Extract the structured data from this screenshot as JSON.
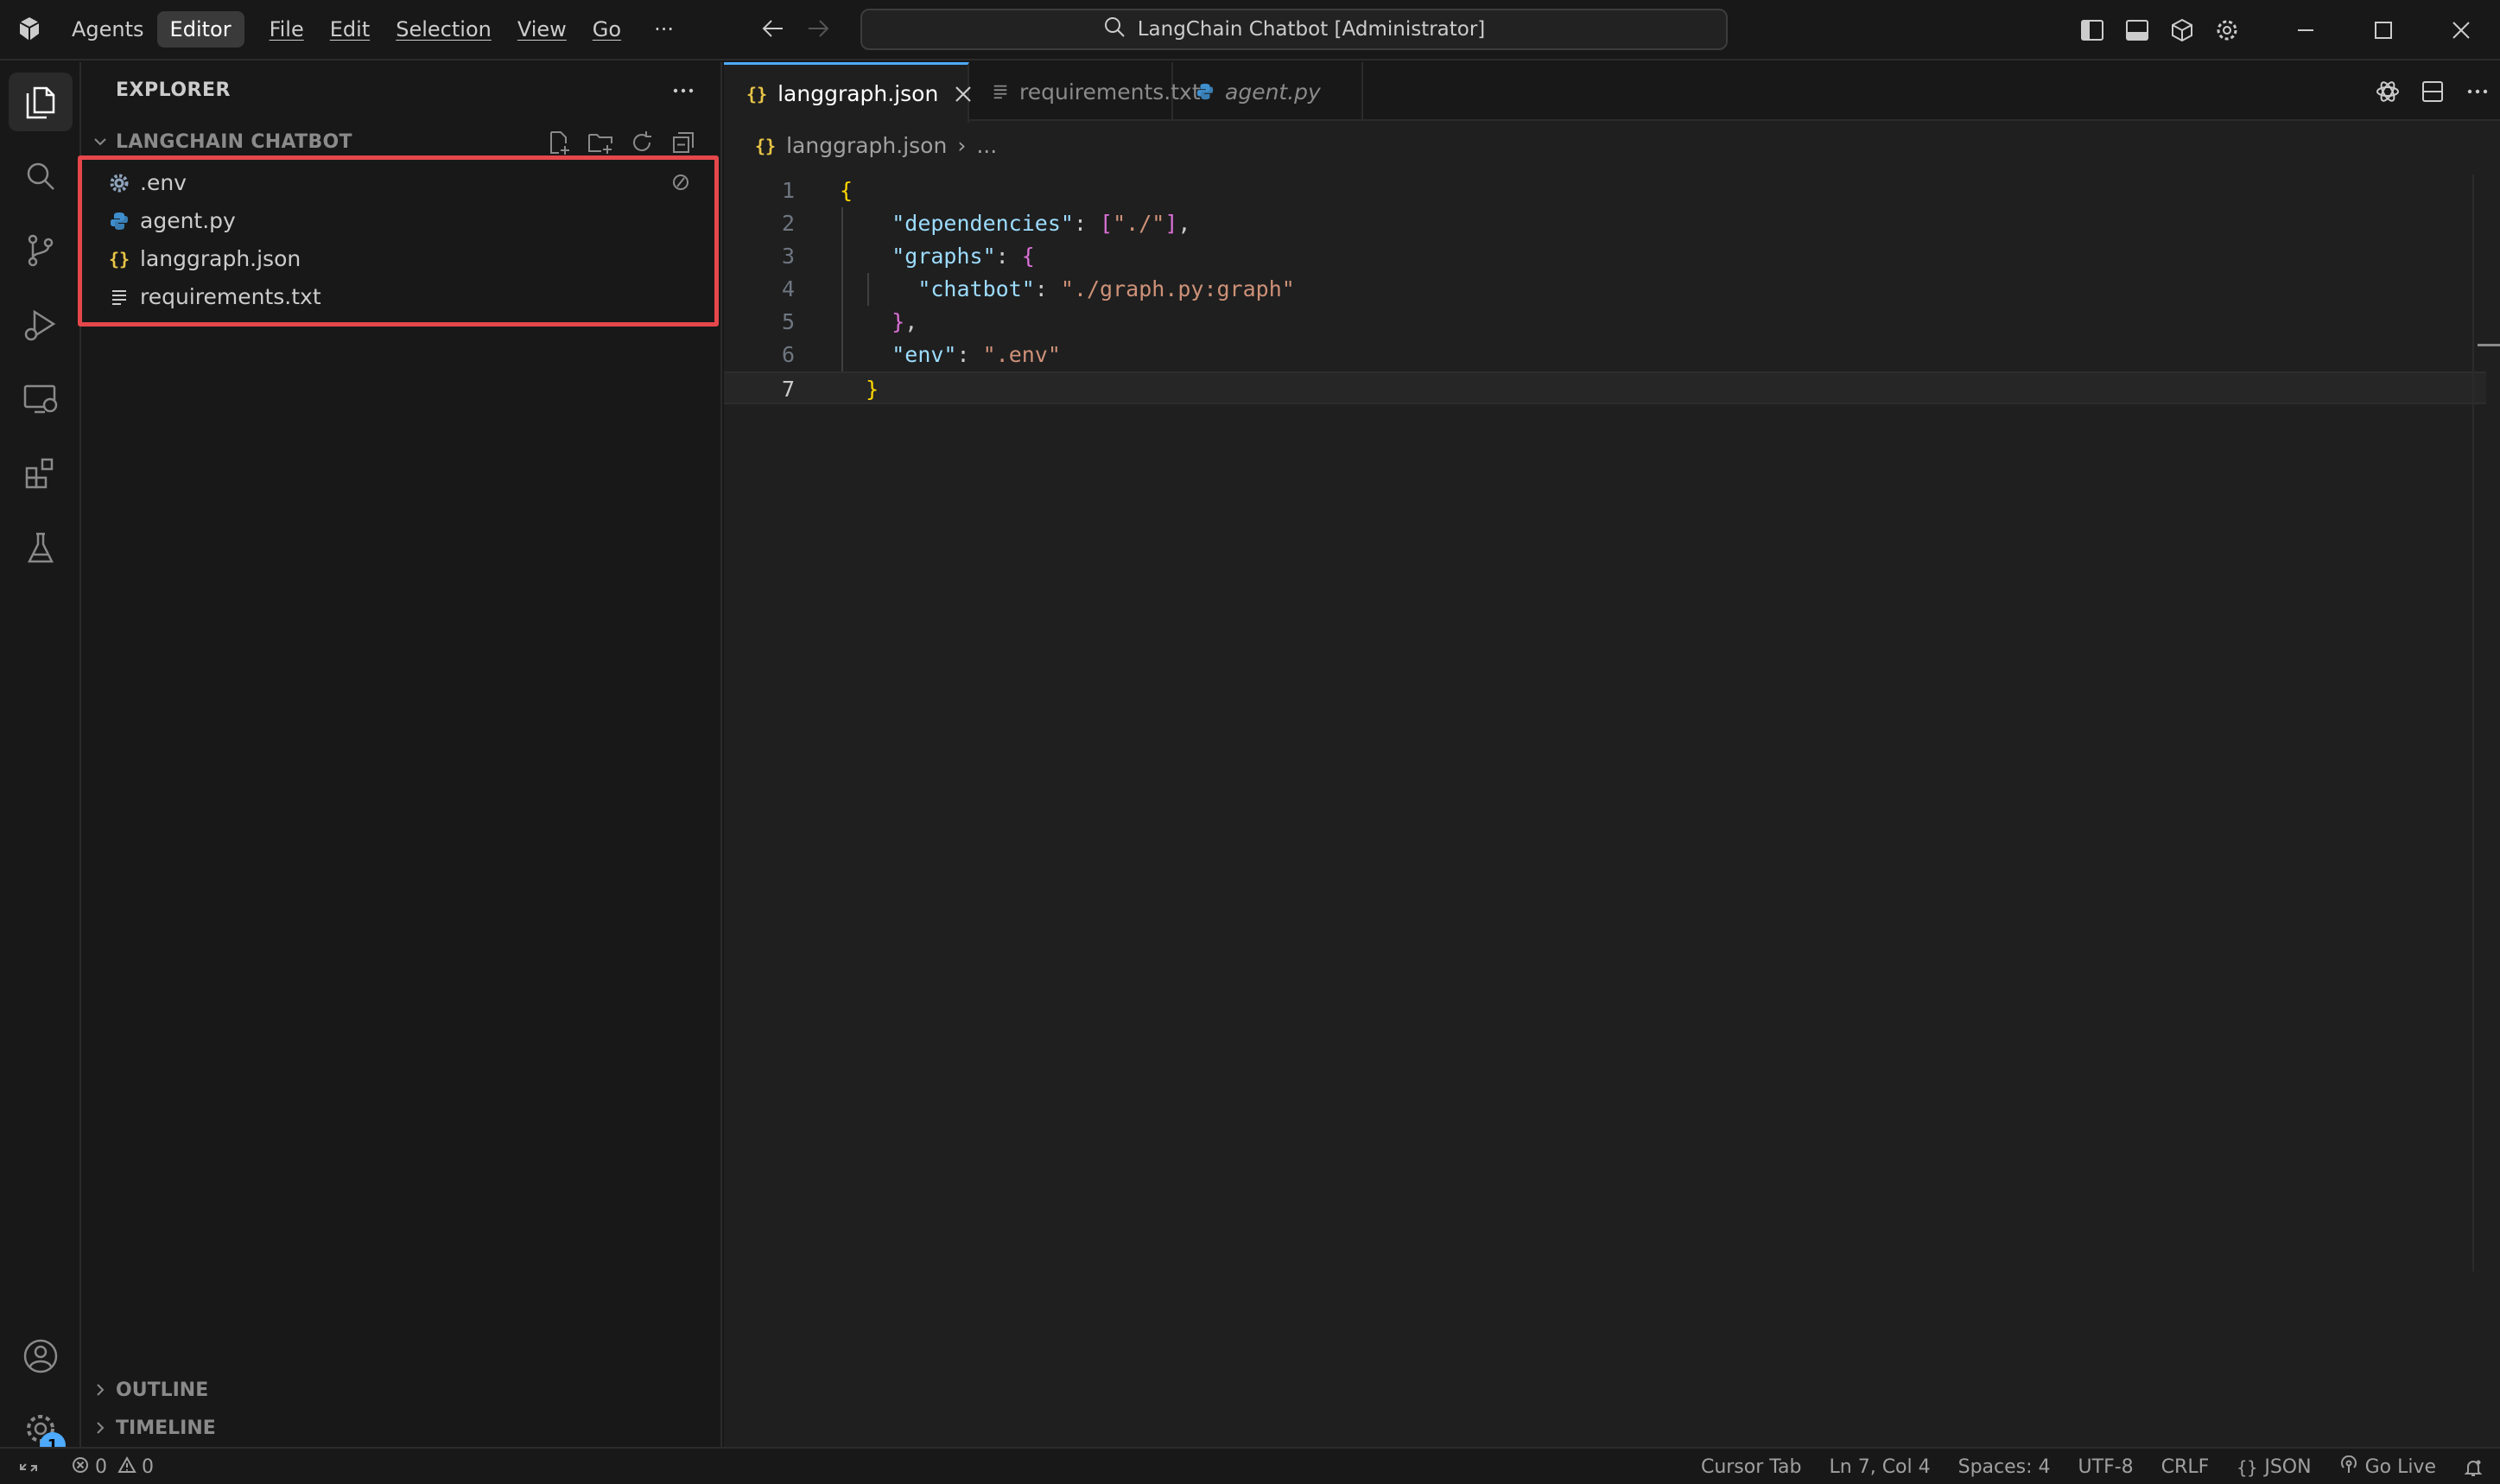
{
  "titlebar": {
    "menu": [
      {
        "label": "Agents",
        "active": false,
        "underline": false
      },
      {
        "label": "Editor",
        "active": true,
        "underline": false
      },
      {
        "label": "File",
        "active": false,
        "underline": true
      },
      {
        "label": "Edit",
        "active": false,
        "underline": true
      },
      {
        "label": "Selection",
        "active": false,
        "underline": true
      },
      {
        "label": "View",
        "active": false,
        "underline": true
      },
      {
        "label": "Go",
        "active": false,
        "underline": true
      }
    ],
    "more_label": "···",
    "search_text": "LangChain Chatbot [Administrator]"
  },
  "sidebar": {
    "header": "EXPLORER",
    "folder": "LANGCHAIN CHATBOT",
    "files": [
      {
        "name": ".env",
        "icon": "gear-icon"
      },
      {
        "name": "agent.py",
        "icon": "python-icon"
      },
      {
        "name": "langgraph.json",
        "icon": "json-icon"
      },
      {
        "name": "requirements.txt",
        "icon": "text-file-icon"
      }
    ],
    "sections": [
      "OUTLINE",
      "TIMELINE"
    ],
    "settings_badge": "1"
  },
  "editor": {
    "tabs": [
      {
        "label": "langgraph.json",
        "icon": "json-icon",
        "active": true
      },
      {
        "label": "requirements.txt",
        "icon": "text-file-icon",
        "active": false
      },
      {
        "label": "agent.py",
        "icon": "python-icon",
        "active": false
      }
    ],
    "breadcrumb": {
      "file": "langgraph.json",
      "separator": "›",
      "rest": "..."
    },
    "line_numbers": [
      "1",
      "2",
      "3",
      "4",
      "5",
      "6",
      "7"
    ],
    "current_line": 7
  },
  "statusbar": {
    "errors": "0",
    "warnings": "0",
    "items": [
      "Cursor Tab",
      "Ln 7, Col 4",
      "Spaces: 4",
      "UTF-8",
      "CRLF"
    ],
    "language": "JSON",
    "golive": "Go Live"
  },
  "colors": {
    "accent": "#4daafc",
    "highlight_box": "#e5474b",
    "json_key": "#9cdcfe",
    "json_string": "#ce9178",
    "bracket_gold": "#ffd700",
    "bracket_orchid": "#da70d6"
  }
}
